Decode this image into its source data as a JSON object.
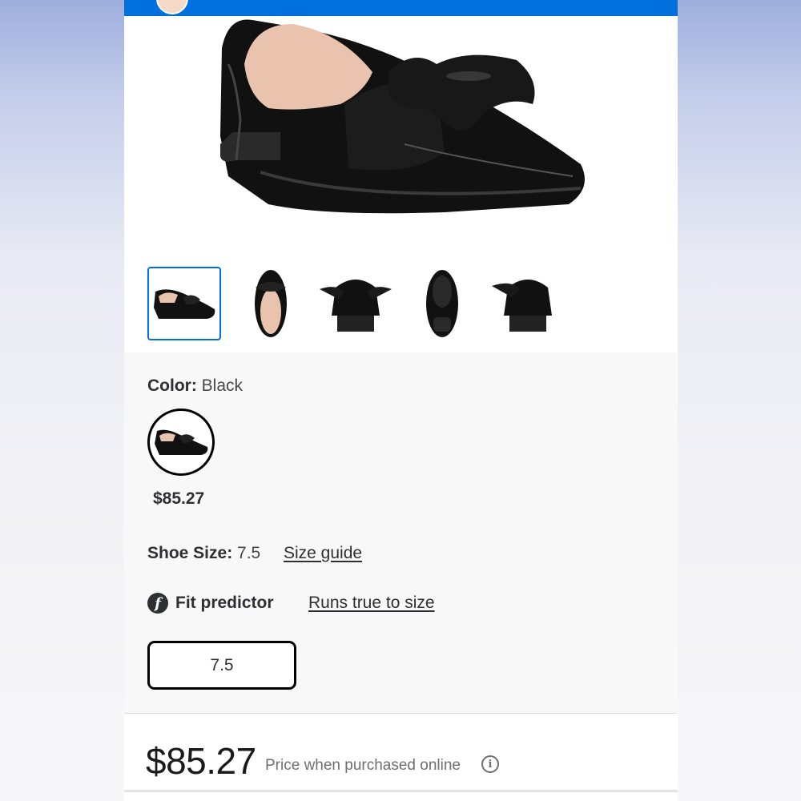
{
  "colors": {
    "brand_blue": "#0071dc",
    "text": "#2e2f32",
    "muted": "#6d6e71"
  },
  "product": {
    "thumbnails": [
      {
        "name": "side-view",
        "selected": true
      },
      {
        "name": "top-view",
        "selected": false
      },
      {
        "name": "back-view",
        "selected": false
      },
      {
        "name": "sole-view",
        "selected": false
      },
      {
        "name": "front-view",
        "selected": false
      }
    ]
  },
  "color": {
    "label": "Color:",
    "value": "Black",
    "swatch_price": "$85.27"
  },
  "size": {
    "label": "Shoe Size:",
    "value": "7.5",
    "guide_link": "Size guide",
    "selected_option": "7.5"
  },
  "fit": {
    "icon": "fit-predictor-icon",
    "label": "Fit predictor",
    "value": "Runs true to size"
  },
  "price": {
    "amount": "$85.27",
    "note": "Price when purchased online",
    "info_icon": "info-icon"
  }
}
